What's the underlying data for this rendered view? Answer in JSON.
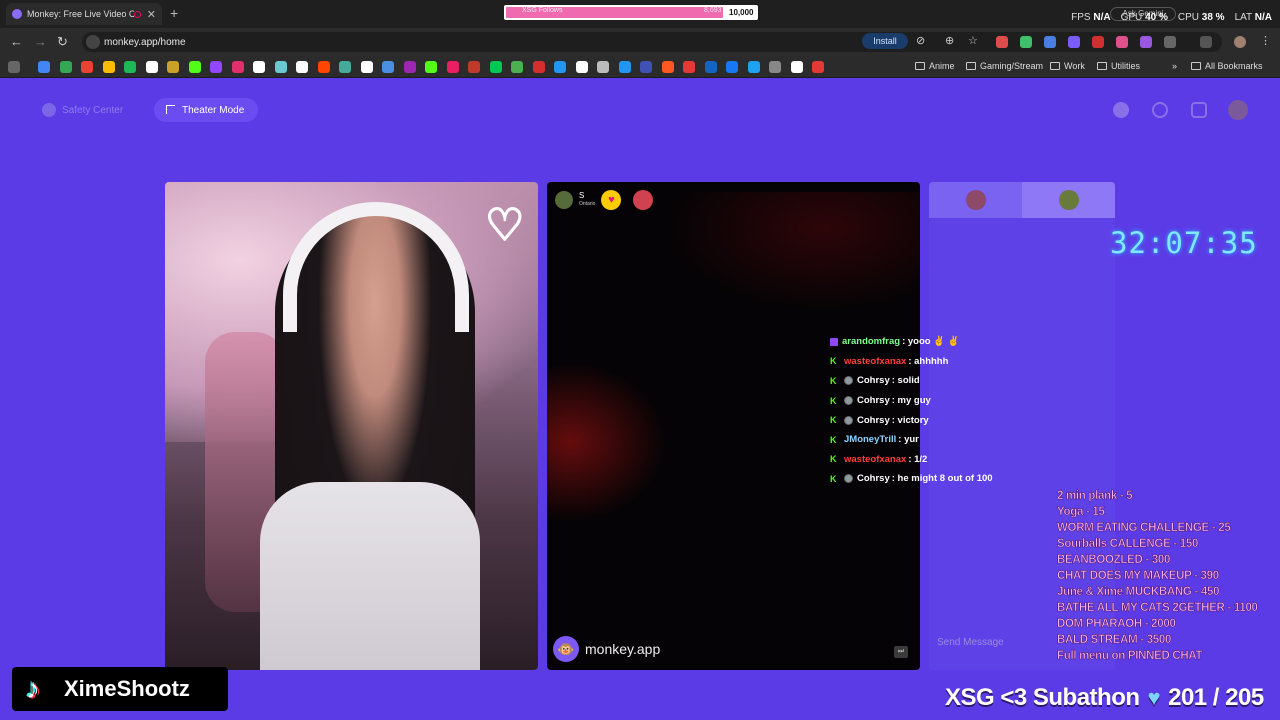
{
  "browser": {
    "tab_title": "Monkey: Free Live Video Ch",
    "url": "monkey.app/home",
    "install_label": "Install",
    "follow_goal": {
      "label": "XSG Follows",
      "current": "8,693",
      "goal": "10,000",
      "fraction": 0.869
    },
    "perf": {
      "fps_label": "FPS",
      "fps": "N/A",
      "gpu_label": "GPU",
      "gpu": "40 %",
      "cpu_label": "CPU",
      "cpu": "38 %",
      "lat_label": "LAT",
      "lat": "N/A"
    },
    "ask_gemini": "Ask Gemini",
    "bookmark_folders": [
      "Anime",
      "Gaming/Stream",
      "Work",
      "Utilities"
    ],
    "all_bookmarks": "All Bookmarks"
  },
  "app": {
    "safety_center": "Safety Center",
    "theater_mode": "Theater Mode",
    "peer": {
      "name": "S",
      "location": "Ontario"
    },
    "brand": "monkey.app",
    "send_placeholder": "Send Message"
  },
  "overlay": {
    "timer": "32:07:35",
    "chat": [
      {
        "platform": "twitch",
        "user": "arandomfrag",
        "user_color": "#7dff8a",
        "message": ": yooo ✌ ✌",
        "mod": false
      },
      {
        "platform": "kick",
        "user": "wasteofxanax",
        "user_color": "#ff3d3d",
        "message": ": ahhhhh",
        "mod": false
      },
      {
        "platform": "kick",
        "user": "Cohrsy",
        "user_color": "#ffffff",
        "message": ": solid",
        "mod": true
      },
      {
        "platform": "kick",
        "user": "Cohrsy",
        "user_color": "#ffffff",
        "message": ": my guy",
        "mod": true
      },
      {
        "platform": "kick",
        "user": "Cohrsy",
        "user_color": "#ffffff",
        "message": ": victory",
        "mod": true
      },
      {
        "platform": "kick",
        "user": "JMoneyTrill",
        "user_color": "#8fd3ff",
        "message": ": yur",
        "mod": false
      },
      {
        "platform": "kick",
        "user": "wasteofxanax",
        "user_color": "#ff3d3d",
        "message": ": 1/2",
        "mod": false
      },
      {
        "platform": "kick",
        "user": "Cohrsy",
        "user_color": "#ffffff",
        "message": ": he might 8 out of 100",
        "mod": true
      }
    ],
    "menu": [
      "2 min plank - 5",
      "Yoga - 15",
      "WORM EATING CHALLENGE - 25",
      "Sourballs CALLENGE - 150",
      "BEANBOOZLED - 300",
      "CHAT DOES MY MAKEUP - 390",
      "June & Xime MUCKBANG - 450",
      "BATHE ALL MY CATS 2GETHER - 1100",
      "DOM PHARAOH - 2000",
      "BALD STREAM - 3500",
      "Full menu on PINNED CHAT"
    ],
    "handle": "XimeShootz",
    "subathon": {
      "title": "XSG <3 Subathon",
      "count": "201 / 205"
    }
  },
  "colors": {
    "app_bg": "#5b3be6",
    "accent": "#7c58f5",
    "timer": "#7fe7ff",
    "menu_text": "#ffb3f0"
  }
}
